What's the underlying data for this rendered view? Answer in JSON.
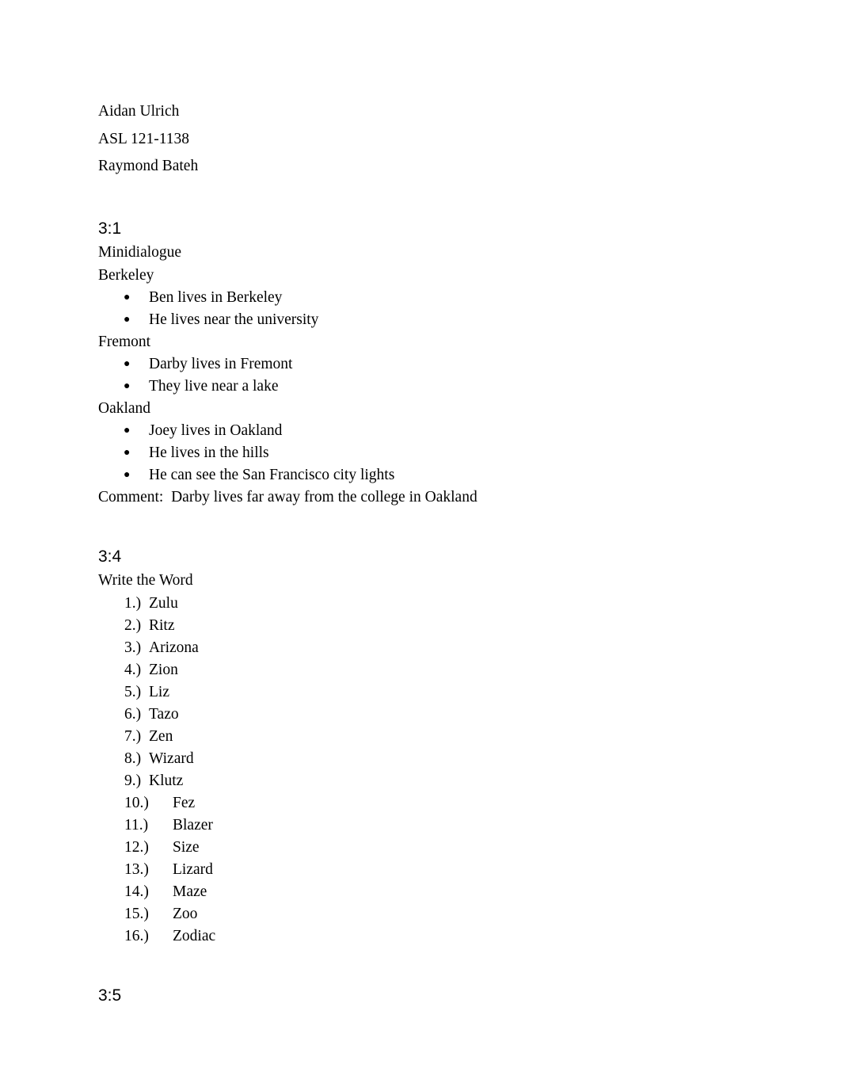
{
  "document": {
    "background_color": "#ffffff",
    "text_color": "#000000",
    "header": {
      "student_name": "Aidan Ulrich",
      "course": "ASL 121-1138",
      "instructor": "Raymond Bateh"
    },
    "sections": [
      {
        "heading": "3:1",
        "subtitle": "Minidialogue",
        "groups": [
          {
            "label": "Berkeley",
            "bullets": [
              "Ben lives in Berkeley",
              "He lives near the university"
            ]
          },
          {
            "label": "Fremont",
            "bullets": [
              "Darby lives in Fremont",
              "They live near a lake"
            ]
          },
          {
            "label": "Oakland",
            "bullets": [
              "Joey lives in Oakland",
              "He lives in the hills",
              "He can see the San Francisco city lights"
            ]
          }
        ],
        "comment_label": "Comment:",
        "comment_text": "Darby lives far away from the college in Oakland"
      },
      {
        "heading": "3:4",
        "subtitle": "Write the Word",
        "items": [
          {
            "marker": "1.)",
            "text": "Zulu"
          },
          {
            "marker": "2.)",
            "text": "Ritz"
          },
          {
            "marker": "3.)",
            "text": "Arizona"
          },
          {
            "marker": "4.)",
            "text": "Zion"
          },
          {
            "marker": "5.)",
            "text": "Liz"
          },
          {
            "marker": "6.)",
            "text": "Tazo"
          },
          {
            "marker": "7.)",
            "text": "Zen"
          },
          {
            "marker": "8.)",
            "text": "Wizard"
          },
          {
            "marker": "9.)",
            "text": "Klutz"
          },
          {
            "marker": "10.)",
            "text": "Fez"
          },
          {
            "marker": "11.)",
            "text": "Blazer"
          },
          {
            "marker": "12.)",
            "text": "Size"
          },
          {
            "marker": "13.)",
            "text": "Lizard"
          },
          {
            "marker": "14.)",
            "text": "Maze"
          },
          {
            "marker": "15.)",
            "text": "Zoo"
          },
          {
            "marker": "16.)",
            "text": "Zodiac"
          }
        ]
      },
      {
        "heading": "3:5"
      }
    ],
    "bullet_glyph": "●"
  }
}
